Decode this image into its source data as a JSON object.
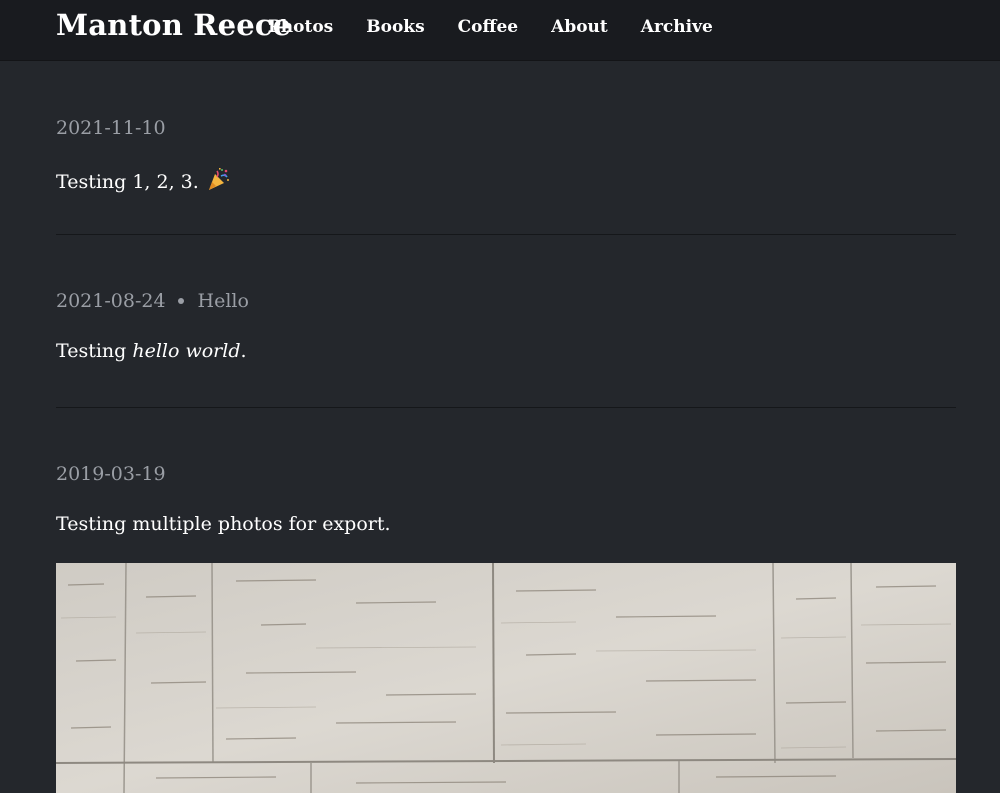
{
  "header": {
    "site_title": "Manton Reece",
    "nav": [
      "Photos",
      "Books",
      "Coffee",
      "About",
      "Archive"
    ]
  },
  "posts": [
    {
      "date": "2021-11-10",
      "body": "Testing 1, 2, 3.",
      "emoji": "party-popper-icon"
    },
    {
      "date": "2021-08-24",
      "title": "Hello",
      "body_prefix": "Testing ",
      "body_emphasis": "hello world",
      "body_suffix": "."
    },
    {
      "date": "2019-03-19",
      "body": "Testing multiple photos for export.",
      "photo": "travertine-wall-photo"
    }
  ],
  "colors": {
    "background": "#24272c",
    "header_background": "#191b1f",
    "muted_text": "#9a9ea5",
    "text": "#ffffff"
  }
}
